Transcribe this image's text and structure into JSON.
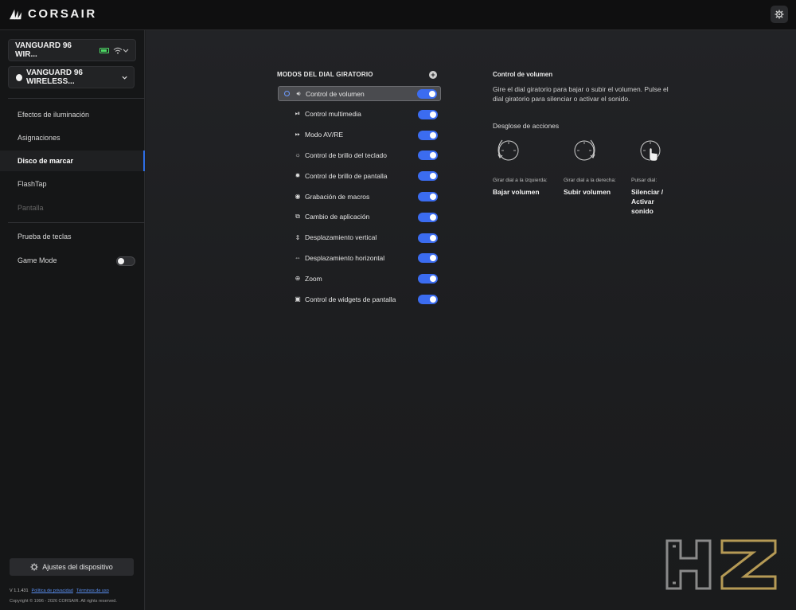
{
  "app": {
    "brand": "CORSAIR"
  },
  "sidebar": {
    "device_primary": "VANGUARD 96 WIR...",
    "device_secondary": "VANGUARD 96 WIRELESS...",
    "nav": [
      {
        "label": "Efectos de iluminación",
        "state": "normal"
      },
      {
        "label": "Asignaciones",
        "state": "normal"
      },
      {
        "label": "Disco de marcar",
        "state": "active"
      },
      {
        "label": "FlashTap",
        "state": "normal"
      },
      {
        "label": "Pantalla",
        "state": "disabled"
      }
    ],
    "tools": [
      {
        "label": "Prueba de teclas"
      },
      {
        "label": "Game Mode",
        "toggle": false
      }
    ],
    "settings_button": "Ajustes del dispositivo",
    "version": "V 1.1.431",
    "privacy_link": "Política de privacidad",
    "terms_link": "Términos de uso",
    "copyright": "Copyright © 1996 - 2026 CORSAIR. All rights reserved."
  },
  "modes": {
    "title": "MODOS DEL DIAL GIRATORIO",
    "items": [
      {
        "label": "Control de volumen",
        "icon": "volume-icon",
        "glyph": "🔊︎",
        "enabled": true,
        "selected": true
      },
      {
        "label": "Control multimedia",
        "icon": "media-icon",
        "glyph": "⏯︎",
        "enabled": true
      },
      {
        "label": "Modo AV/RE",
        "icon": "fast-forward-icon",
        "glyph": "⏩︎",
        "enabled": true
      },
      {
        "label": "Control de brillo del teclado",
        "icon": "keyboard-brightness-icon",
        "glyph": "☼",
        "enabled": true
      },
      {
        "label": "Control de brillo de pantalla",
        "icon": "screen-brightness-icon",
        "glyph": "✹",
        "enabled": true
      },
      {
        "label": "Grabación de macros",
        "icon": "record-icon",
        "glyph": "◉",
        "enabled": true
      },
      {
        "label": "Cambio de aplicación",
        "icon": "app-switch-icon",
        "glyph": "⧉",
        "enabled": true
      },
      {
        "label": "Desplazamiento vertical",
        "icon": "vertical-scroll-icon",
        "glyph": "⇕",
        "enabled": true
      },
      {
        "label": "Desplazamiento horizontal",
        "icon": "horizontal-scroll-icon",
        "glyph": "⇔",
        "enabled": true
      },
      {
        "label": "Zoom",
        "icon": "zoom-icon",
        "glyph": "⊕",
        "enabled": true
      },
      {
        "label": "Control de widgets de pantalla",
        "icon": "widgets-icon",
        "glyph": "▣",
        "enabled": true
      }
    ]
  },
  "detail": {
    "title": "Control de volumen",
    "description": "Gire el dial giratorio para bajar o subir el volumen. Pulse el dial giratorio para silenciar o activar el sonido.",
    "breakdown_title": "Desglose de acciones",
    "actions": [
      {
        "label": "Girar dial a la izquierda:",
        "value": "Bajar volumen",
        "icon": "rotate-left-icon"
      },
      {
        "label": "Girar dial a la derecha:",
        "value": "Subir volumen",
        "icon": "rotate-right-icon"
      },
      {
        "label": "Pulsar dial:",
        "value": "Silenciar / Activar sonido",
        "icon": "press-dial-icon"
      }
    ]
  },
  "colors": {
    "accent": "#3b6cf0",
    "battery": "#4cd964",
    "link": "#5a8ff0"
  }
}
